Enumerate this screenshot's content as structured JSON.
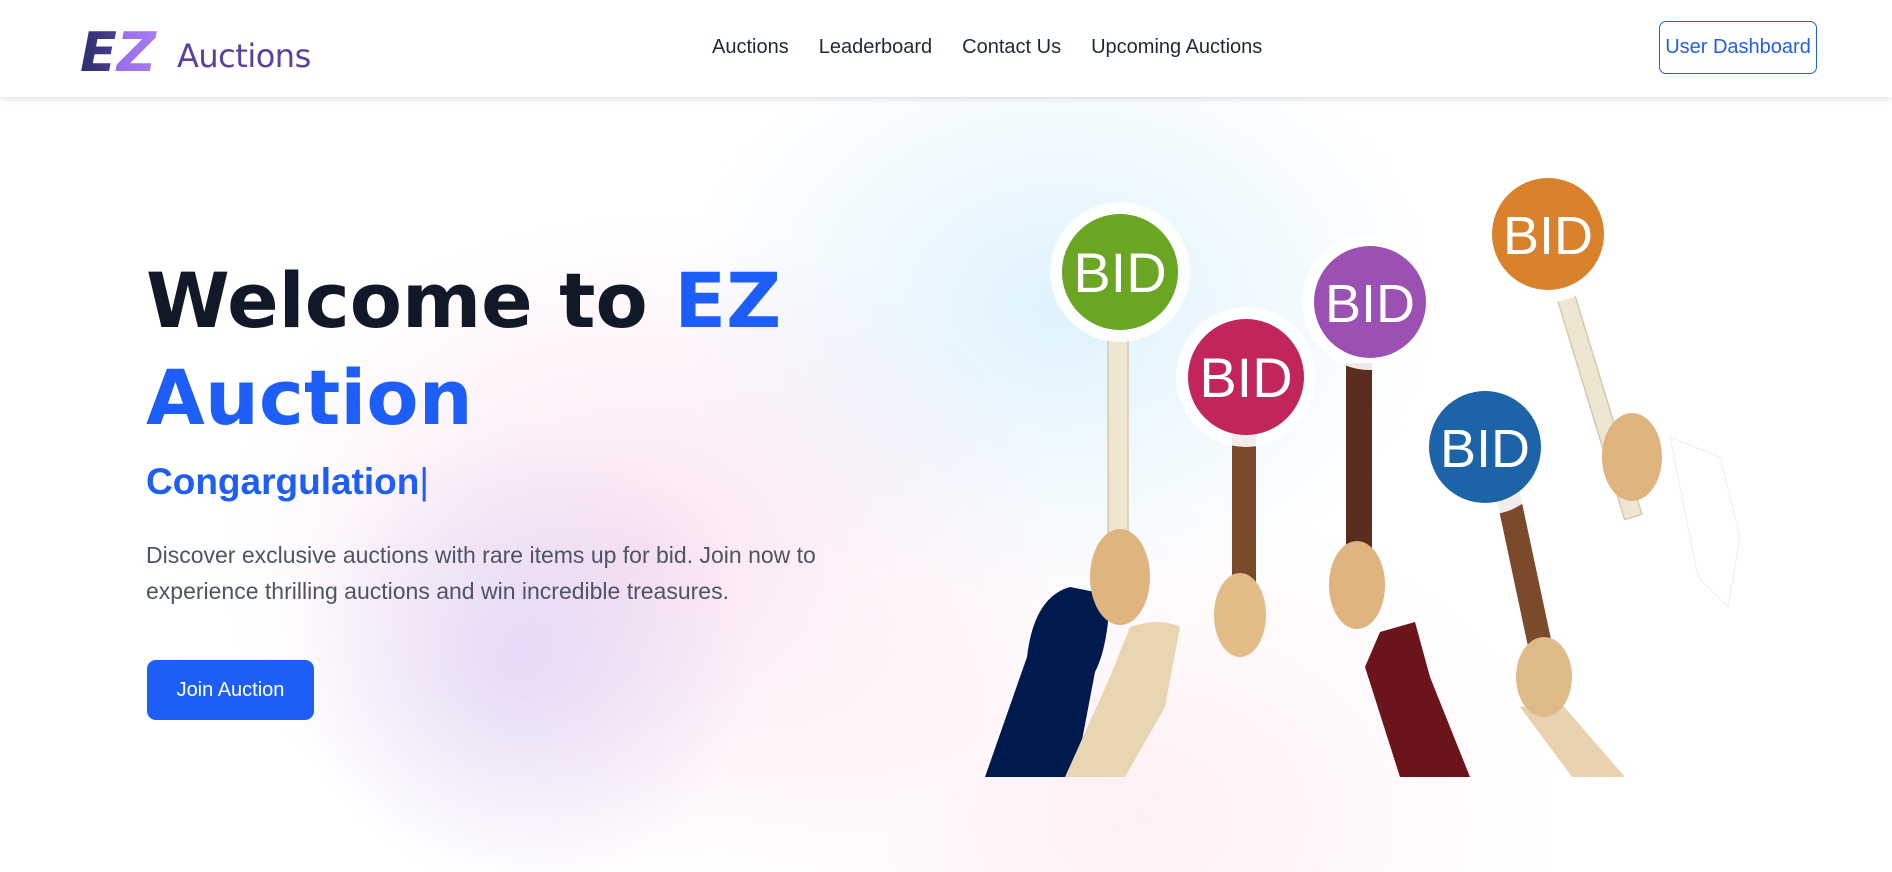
{
  "header": {
    "logo": {
      "mark": "EZ",
      "text": "Auctions"
    },
    "nav": [
      "Auctions",
      "Leaderboard",
      "Contact Us",
      "Upcoming Auctions"
    ],
    "dashboard_label": "User Dashboard"
  },
  "hero": {
    "title_part1": "Welcome to ",
    "title_accent": "EZ Auction",
    "subtitle": "Congargulation",
    "cursor": "|",
    "description": "Discover exclusive auctions with rare items up for bid. Join now to experience thrilling auctions and win incredible treasures.",
    "cta_label": "Join Auction",
    "paddle_text": "BID"
  },
  "colors": {
    "brand_blue": "#1d5ef8",
    "brand_purple": "#5b3fa3",
    "paddle_green": "#6aa623",
    "paddle_red": "#c2255c",
    "paddle_purple": "#9b50b4",
    "paddle_blue": "#1c63a8",
    "paddle_orange": "#d9822b"
  }
}
